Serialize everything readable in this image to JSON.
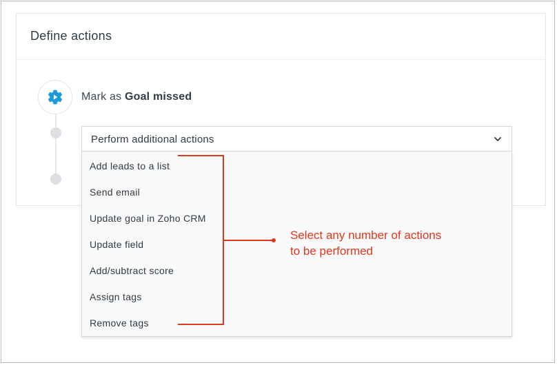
{
  "panel": {
    "title": "Define actions"
  },
  "step": {
    "prefix": "Mark as ",
    "emphasis": "Goal missed",
    "icon": "gear-icon",
    "icon_color": "#1a9ad6"
  },
  "action_select": {
    "value": "Perform additional actions",
    "icon": "chevron-down-icon"
  },
  "action_menu": {
    "items": [
      {
        "label": "Add leads to a list"
      },
      {
        "label": "Send email"
      },
      {
        "label": "Update goal in Zoho CRM"
      },
      {
        "label": "Update field"
      },
      {
        "label": "Add/subtract score"
      },
      {
        "label": "Assign tags"
      },
      {
        "label": "Remove tags"
      }
    ]
  },
  "annotation": {
    "line1": "Select any number of actions",
    "line2": "to be performed",
    "color": "#e2361c"
  }
}
